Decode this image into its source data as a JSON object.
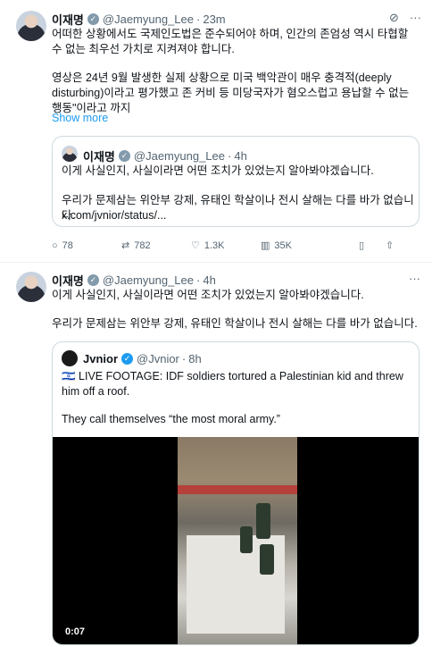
{
  "tweet1": {
    "name": "이재명",
    "handle": "@Jaemyung_Lee",
    "time": "23m",
    "text1": "어떠한 상황에서도 국제인도법은 준수되어야 하며, 인간의 존엄성 역시 타협할 수 없는 최우선 가치로 지켜져야 합니다.",
    "text2": "영상은 24년 9월 발생한 실제 상황으로 미국 백악관이 매우 충격적(deeply disturbing)이라고 평가했고 존 커비 등 미당국자가 혐오스럽고 용납할 수 없는 행동\"이라고 까지",
    "show_more": "Show more",
    "quote": {
      "name": "이재명",
      "handle": "@Jaemyung_Lee",
      "time": "4h",
      "line1": "이게 사실인지, 사실이라면 어떤 조치가 있었는지 알아봐야겠습니다.",
      "line2": "우리가 문제삼는 위안부 강제, 유태인 학살이나 전시 살해는 다를 바가 없습니다.",
      "link": "x.com/jvnior/status/..."
    },
    "actions": {
      "replies": "78",
      "reposts": "782",
      "likes": "1.3K",
      "views": "35K"
    }
  },
  "tweet2": {
    "name": "이재명",
    "handle": "@Jaemyung_Lee",
    "time": "4h",
    "line1": "이게 사실인지, 사실이라면 어떤 조치가 있었는지 알아봐야겠습니다.",
    "line2": "우리가 문제삼는 위안부 강제, 유태인 학살이나 전시 살해는 다를 바가 없습니다.",
    "quote": {
      "name": "Jvnior",
      "handle": "@Jvnior",
      "time": "8h",
      "text1": "🇮🇱 LIVE FOOTAGE: IDF soldiers tortured a Palestinian kid and threw him off a roof.",
      "text2": "They call themselves “the most moral army.”",
      "video_time": "0:07"
    }
  },
  "dot": "·",
  "more_icon": "···"
}
